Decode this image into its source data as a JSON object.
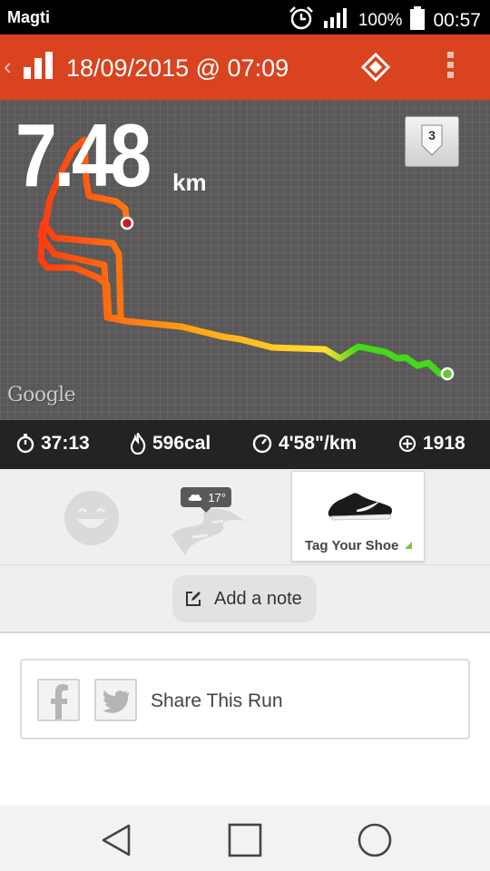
{
  "status_bar": {
    "carrier": "Magti",
    "battery": "100%",
    "time": "00:57",
    "icons": [
      "alarm-icon",
      "signal-icon",
      "battery-icon"
    ]
  },
  "header": {
    "title": "18/09/2015 @ 07:09",
    "icons": [
      "back-chevron-icon",
      "activity-bars-icon",
      "diamond-icon",
      "overflow-menu-icon"
    ],
    "color": "#d9431f"
  },
  "map": {
    "distance_value": "7.48",
    "distance_unit": "km",
    "lap_badge": "3",
    "watermark": "Google",
    "route_colors": [
      "#ff3b10",
      "#ffa010",
      "#ffe030",
      "#44d81a"
    ]
  },
  "stats": {
    "duration": "37:13",
    "calories": "596cal",
    "pace": "4'58\"/km",
    "fuel": "1918",
    "icons": [
      "stopwatch-icon",
      "flame-icon",
      "pace-gauge-icon",
      "fuel-plus-icon"
    ]
  },
  "tags": {
    "weather_temp": "17°",
    "shoe_label": "Tag Your Shoe",
    "icons": [
      "smiley-mood-icon",
      "terrain-road-icon",
      "cloud-weather-icon",
      "running-shoe-icon"
    ]
  },
  "note": {
    "label": "Add a note",
    "icon": "edit-note-icon"
  },
  "share": {
    "label": "Share This Run",
    "icons": [
      "facebook-icon",
      "twitter-icon"
    ]
  },
  "nav": {
    "icons": [
      "back-triangle-icon",
      "home-square-icon",
      "recents-circle-icon"
    ]
  }
}
